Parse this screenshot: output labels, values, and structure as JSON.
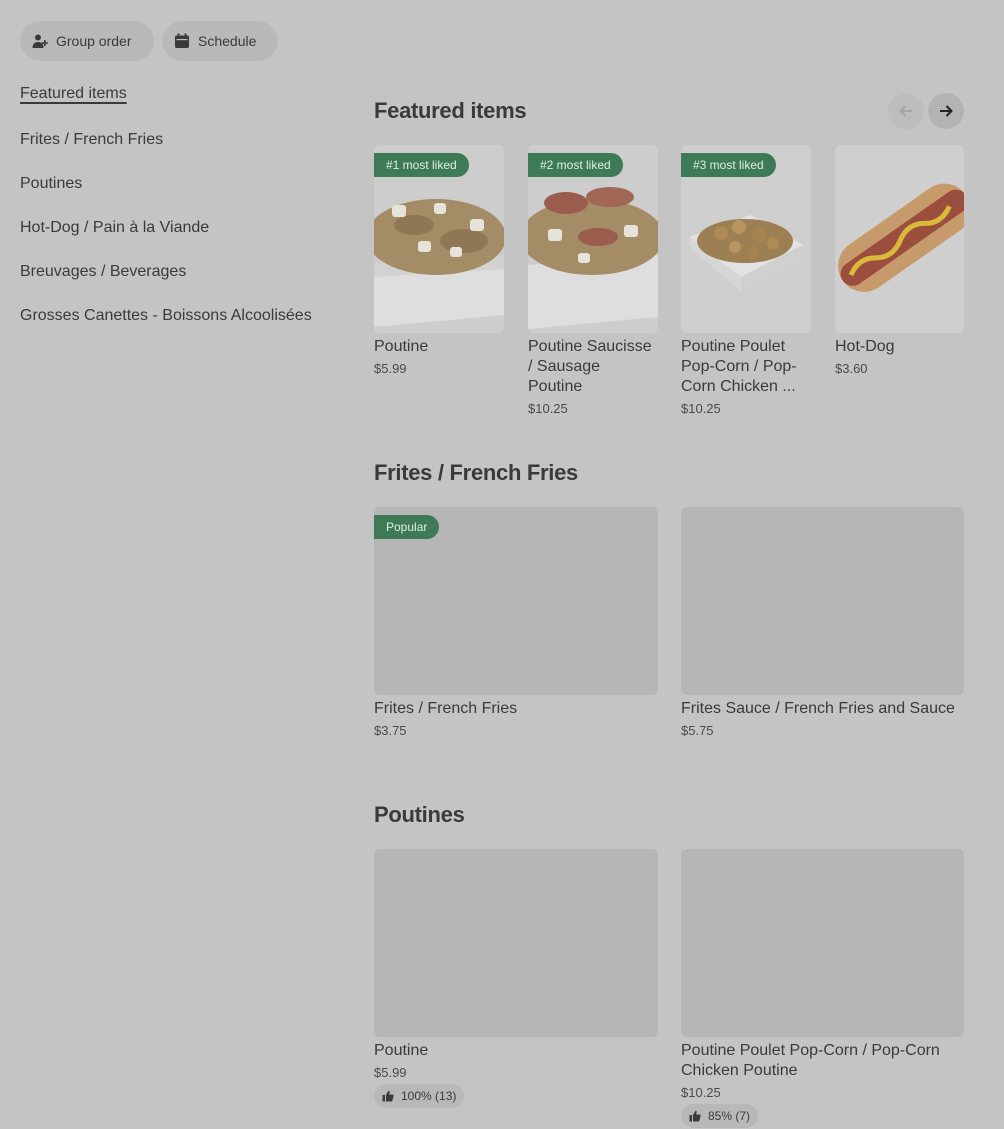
{
  "actions": {
    "group_order": "Group order",
    "schedule": "Schedule"
  },
  "sidebar": {
    "items": [
      {
        "label": "Featured items",
        "active": true
      },
      {
        "label": "Frites / French Fries"
      },
      {
        "label": "Poutines"
      },
      {
        "label": "Hot-Dog / Pain à la Viande"
      },
      {
        "label": "Breuvages / Beverages"
      },
      {
        "label": "Grosses Canettes - Boissons Alcoolisées"
      }
    ]
  },
  "featured": {
    "title": "Featured items",
    "items": [
      {
        "badge": "#1 most liked",
        "name": "Poutine",
        "price": "$5.99"
      },
      {
        "badge": "#2 most liked",
        "name": "Poutine Saucisse / Sausage Poutine",
        "price": "$10.25"
      },
      {
        "badge": "#3 most liked",
        "name": "Poutine Poulet Pop-Corn / Pop-Corn Chicken ...",
        "price": "$10.25"
      },
      {
        "name": "Hot-Dog",
        "price": "$3.60"
      }
    ]
  },
  "fries": {
    "title": "Frites / French Fries",
    "items": [
      {
        "badge": "Popular",
        "name": "Frites / French Fries",
        "price": "$3.75"
      },
      {
        "name": "Frites Sauce / French Fries and Sauce",
        "price": "$5.75"
      }
    ]
  },
  "poutines": {
    "title": "Poutines",
    "items": [
      {
        "name": "Poutine",
        "price": "$5.99",
        "rating": "100% (13)",
        "rating_fraction": 1.0
      },
      {
        "name": "Poutine Poulet Pop-Corn / Pop-Corn Chicken Poutine",
        "price": "$10.25",
        "rating": "85% (7)",
        "rating_fraction": 0.85
      }
    ]
  },
  "colors": {
    "background": "#c4c4c4",
    "badge": "#3e7a55",
    "text": "#3a3a3a"
  },
  "icons": {
    "group_order": "add-person-icon",
    "schedule": "calendar-icon",
    "prev": "arrow-left-icon",
    "next": "arrow-right-icon",
    "rating": "thumbs-up-icon"
  }
}
